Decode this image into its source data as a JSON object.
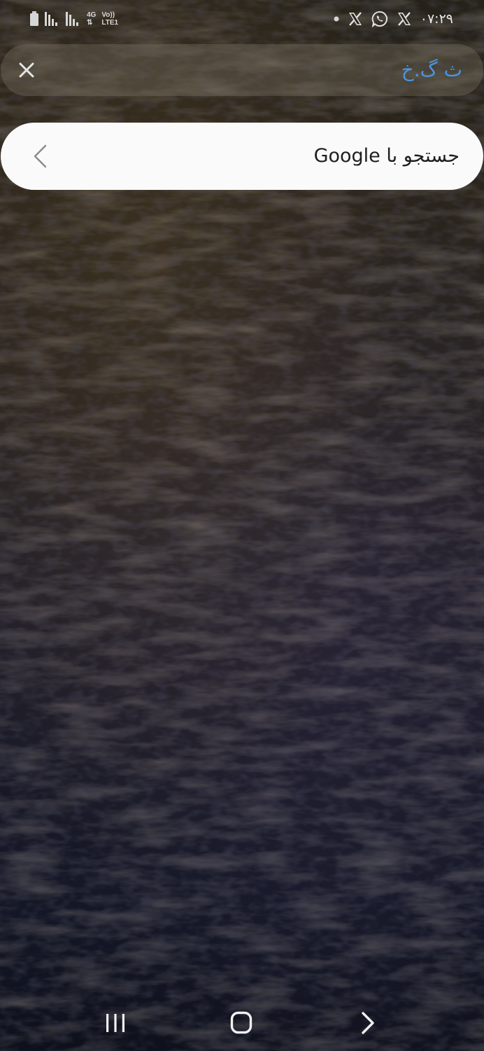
{
  "status_bar": {
    "time": "۰۷:۲۹",
    "network_type": "4G",
    "volte_label": "Vo))",
    "lte_label": "LTE1",
    "notification_icons": [
      "x-icon",
      "whatsapp-icon",
      "x-icon"
    ],
    "battery_icon": "battery-icon",
    "signal_icons": [
      "signal-icon",
      "signal-icon"
    ]
  },
  "search_bar": {
    "query": "ث گ.خ",
    "clear_icon": "close-icon"
  },
  "suggestion": {
    "label": "جستجو با Google",
    "icon": "chevron-left-icon"
  },
  "nav_bar": {
    "buttons": [
      "recent-apps-icon",
      "home-icon",
      "back-icon"
    ]
  },
  "colors": {
    "query_text": "#4a95de",
    "suggestion_bg": "#fafafa",
    "search_pill_bg": "rgba(120,112,96,0.38)"
  }
}
